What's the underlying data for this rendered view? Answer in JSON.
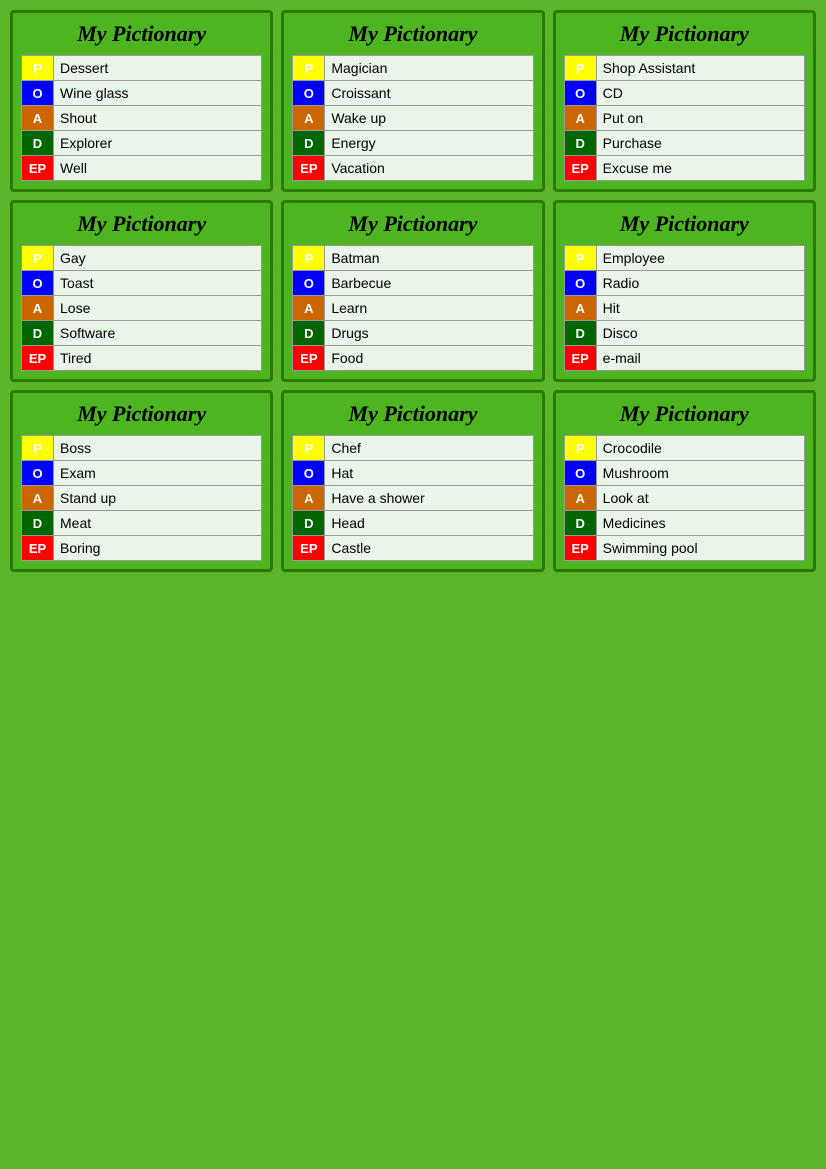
{
  "cards": [
    {
      "title": "My Pictionary",
      "rows": [
        {
          "label": "P",
          "word": "Dessert"
        },
        {
          "label": "O",
          "word": "Wine glass"
        },
        {
          "label": "A",
          "word": "Shout"
        },
        {
          "label": "D",
          "word": "Explorer"
        },
        {
          "label": "EP",
          "word": "Well"
        }
      ]
    },
    {
      "title": "My Pictionary",
      "rows": [
        {
          "label": "P",
          "word": "Magician"
        },
        {
          "label": "O",
          "word": "Croissant"
        },
        {
          "label": "A",
          "word": "Wake up"
        },
        {
          "label": "D",
          "word": "Energy"
        },
        {
          "label": "EP",
          "word": "Vacation"
        }
      ]
    },
    {
      "title": "My Pictionary",
      "rows": [
        {
          "label": "P",
          "word": "Shop Assistant"
        },
        {
          "label": "O",
          "word": "CD"
        },
        {
          "label": "A",
          "word": "Put on"
        },
        {
          "label": "D",
          "word": "Purchase"
        },
        {
          "label": "EP",
          "word": "Excuse me"
        }
      ]
    },
    {
      "title": "My Pictionary",
      "rows": [
        {
          "label": "P",
          "word": "Gay"
        },
        {
          "label": "O",
          "word": "Toast"
        },
        {
          "label": "A",
          "word": "Lose"
        },
        {
          "label": "D",
          "word": "Software"
        },
        {
          "label": "EP",
          "word": "Tired"
        }
      ]
    },
    {
      "title": "My Pictionary",
      "rows": [
        {
          "label": "P",
          "word": "Batman"
        },
        {
          "label": "O",
          "word": "Barbecue"
        },
        {
          "label": "A",
          "word": "Learn"
        },
        {
          "label": "D",
          "word": "Drugs"
        },
        {
          "label": "EP",
          "word": "Food"
        }
      ]
    },
    {
      "title": "My Pictionary",
      "rows": [
        {
          "label": "P",
          "word": "Employee"
        },
        {
          "label": "O",
          "word": "Radio"
        },
        {
          "label": "A",
          "word": "Hit"
        },
        {
          "label": "D",
          "word": "Disco"
        },
        {
          "label": "EP",
          "word": "e-mail"
        }
      ]
    },
    {
      "title": "My Pictionary",
      "rows": [
        {
          "label": "P",
          "word": "Boss"
        },
        {
          "label": "O",
          "word": "Exam"
        },
        {
          "label": "A",
          "word": "Stand up"
        },
        {
          "label": "D",
          "word": "Meat"
        },
        {
          "label": "EP",
          "word": "Boring"
        }
      ]
    },
    {
      "title": "My Pictionary",
      "rows": [
        {
          "label": "P",
          "word": "Chef"
        },
        {
          "label": "O",
          "word": "Hat"
        },
        {
          "label": "A",
          "word": "Have a shower"
        },
        {
          "label": "D",
          "word": "Head"
        },
        {
          "label": "EP",
          "word": "Castle"
        }
      ]
    },
    {
      "title": "My Pictionary",
      "rows": [
        {
          "label": "P",
          "word": "Crocodile"
        },
        {
          "label": "O",
          "word": "Mushroom"
        },
        {
          "label": "A",
          "word": "Look at"
        },
        {
          "label": "D",
          "word": "Medicines"
        },
        {
          "label": "EP",
          "word": "Swimming pool"
        }
      ]
    }
  ]
}
